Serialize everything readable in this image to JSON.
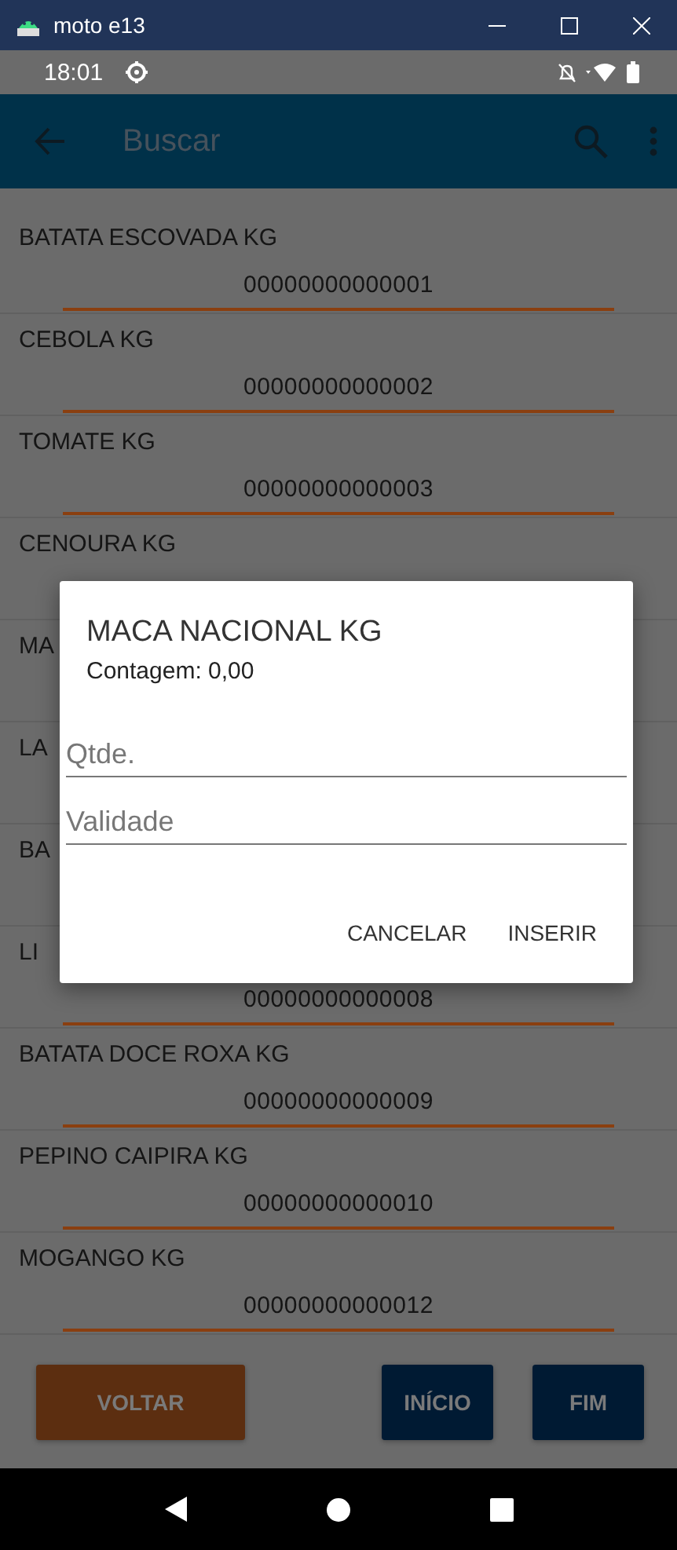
{
  "window": {
    "title": "moto e13"
  },
  "status_bar": {
    "time": "18:01"
  },
  "app_bar": {
    "title": "Buscar"
  },
  "products": [
    {
      "name": "BATATA ESCOVADA KG",
      "code": "00000000000001"
    },
    {
      "name": "CEBOLA KG",
      "code": "00000000000002"
    },
    {
      "name": "TOMATE KG",
      "code": "00000000000003"
    },
    {
      "name": "CENOURA KG"
    },
    {
      "name": "MA"
    },
    {
      "name": "LA"
    },
    {
      "name": "BA"
    },
    {
      "name": "LI",
      "code": "00000000000008"
    },
    {
      "name": "BATATA DOCE ROXA KG",
      "code": "00000000000009"
    },
    {
      "name": "PEPINO CAIPIRA KG",
      "code": "00000000000010"
    },
    {
      "name": "MOGANGO KG",
      "code": "00000000000012"
    }
  ],
  "dialog": {
    "title": "MACA NACIONAL KG",
    "subtitle": "Contagem: 0,00",
    "fields": [
      {
        "placeholder": "Qtde."
      },
      {
        "placeholder": "Validade"
      }
    ],
    "actions": [
      "CANCELAR",
      "INSERIR"
    ]
  },
  "bottom_buttons": [
    {
      "label": "VOLTAR",
      "kind": "back"
    },
    {
      "label": "INÍCIO",
      "kind": "nav"
    },
    {
      "label": "FIM",
      "kind": "nav"
    }
  ]
}
